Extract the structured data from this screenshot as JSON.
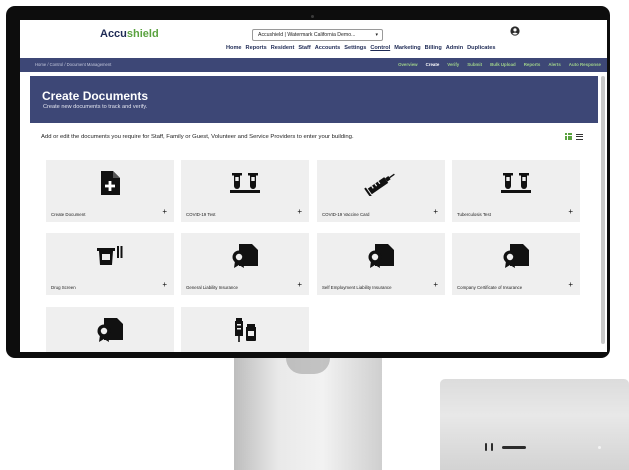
{
  "app": {
    "logo_main": "Accu",
    "logo_accent": "shield",
    "facility_value": "Accushield | Watermark California Demo..."
  },
  "top_nav": [
    "Home",
    "Reports",
    "Resident",
    "Staff",
    "Accounts",
    "Settings",
    "Control",
    "Marketing",
    "Billing",
    "Admin",
    "Duplicates"
  ],
  "top_nav_active": "Control",
  "breadcrumb": "Home  /  Control  /  Document Management",
  "sub_nav": [
    "Overview",
    "Create",
    "Verify",
    "Submit",
    "Bulk Upload",
    "Reports",
    "Alerts",
    "Auto Response"
  ],
  "sub_nav_active": "Create",
  "banner": {
    "title": "Create Documents",
    "subtitle": "Create new documents to track and verify."
  },
  "description": "Add or edit the documents you require for Staff, Family or Guest, Volunteer and Service Providers to enter your building.",
  "cards": [
    {
      "label": "Create Document",
      "icon": "file-plus-icon"
    },
    {
      "label": "COVID-19 Test",
      "icon": "test-tubes-icon"
    },
    {
      "label": "COVID-19 Vaccine Card",
      "icon": "syringe-icon"
    },
    {
      "label": "Tuberculosis Test",
      "icon": "test-tubes-icon"
    },
    {
      "label": "Drug Screen",
      "icon": "cup-icon"
    },
    {
      "label": "General Liability Insurance",
      "icon": "certificate-icon"
    },
    {
      "label": "Self Employment Liability Insurance",
      "icon": "certificate-icon"
    },
    {
      "label": "Company Certificate of Insurance",
      "icon": "certificate-icon"
    },
    {
      "label": "",
      "icon": "certificate-icon"
    },
    {
      "label": "",
      "icon": "vaccine-vial-icon"
    }
  ],
  "add_symbol": "+",
  "colors": {
    "brand_navy": "#3d4776",
    "brand_green": "#5aa23f",
    "card_bg": "#efefef"
  }
}
